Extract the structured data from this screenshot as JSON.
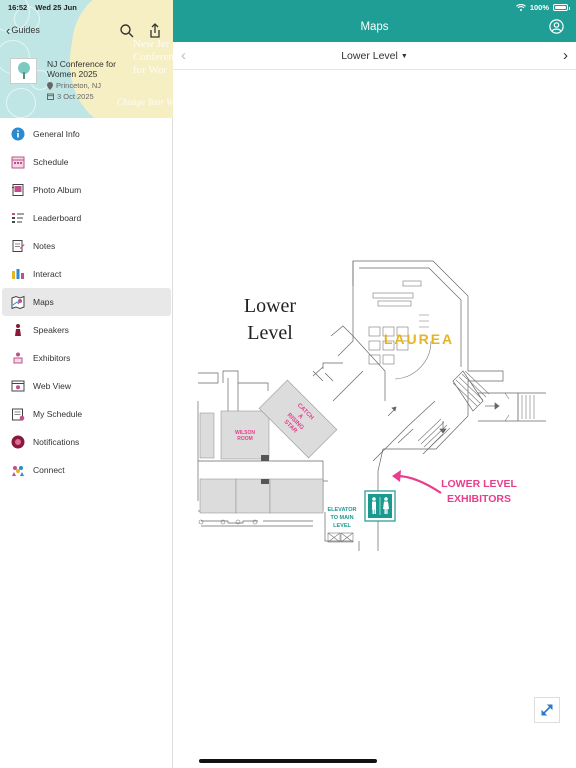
{
  "status_bar": {
    "time": "16:52",
    "date": "Wed 25 Jun",
    "battery": "100%"
  },
  "sidebar": {
    "back_label": "Guides",
    "header_bg_lines": [
      "New Jer",
      "Conferen",
      "for Wor"
    ],
    "header_bg_script": "Change Your W",
    "event": {
      "title": "NJ Conference for Women 2025",
      "location": "Princeton, NJ",
      "date": "3 Oct 2025"
    },
    "items": [
      {
        "label": "General Info",
        "icon": "info-icon"
      },
      {
        "label": "Schedule",
        "icon": "calendar-icon"
      },
      {
        "label": "Photo Album",
        "icon": "photo-album-icon"
      },
      {
        "label": "Leaderboard",
        "icon": "leaderboard-icon"
      },
      {
        "label": "Notes",
        "icon": "notes-icon"
      },
      {
        "label": "Interact",
        "icon": "interact-icon"
      },
      {
        "label": "Maps",
        "icon": "map-icon",
        "active": true
      },
      {
        "label": "Speakers",
        "icon": "speaker-icon"
      },
      {
        "label": "Exhibitors",
        "icon": "exhibitor-icon"
      },
      {
        "label": "Web View",
        "icon": "web-view-icon"
      },
      {
        "label": "My Schedule",
        "icon": "my-schedule-icon"
      },
      {
        "label": "Notifications",
        "icon": "notification-icon"
      },
      {
        "label": "Connect",
        "icon": "connect-icon"
      }
    ]
  },
  "topbar": {
    "title": "Maps"
  },
  "level_selector": {
    "selected": "Lower Level"
  },
  "map": {
    "title_line1": "Lower",
    "title_line2": "Level",
    "brand": "LAUREA",
    "wilson_line1": "WILSON",
    "wilson_line2": "ROOM",
    "catch_lines": [
      "CATCH",
      "A",
      "RISING",
      "STAR"
    ],
    "exhibitors_line1": "LOWER LEVEL",
    "exhibitors_line2": "EXHIBITORS",
    "elevator_lines": [
      "ELEVATOR",
      "TO MAIN",
      "LEVEL"
    ]
  },
  "colors": {
    "topbar": "#1f9e96",
    "accent_pink": "#e83e8c",
    "brand_gold": "#e6b325",
    "elevator_teal": "#1a9a8e",
    "header_teal": "#bfe6e4",
    "header_cream": "#f6efc4"
  }
}
